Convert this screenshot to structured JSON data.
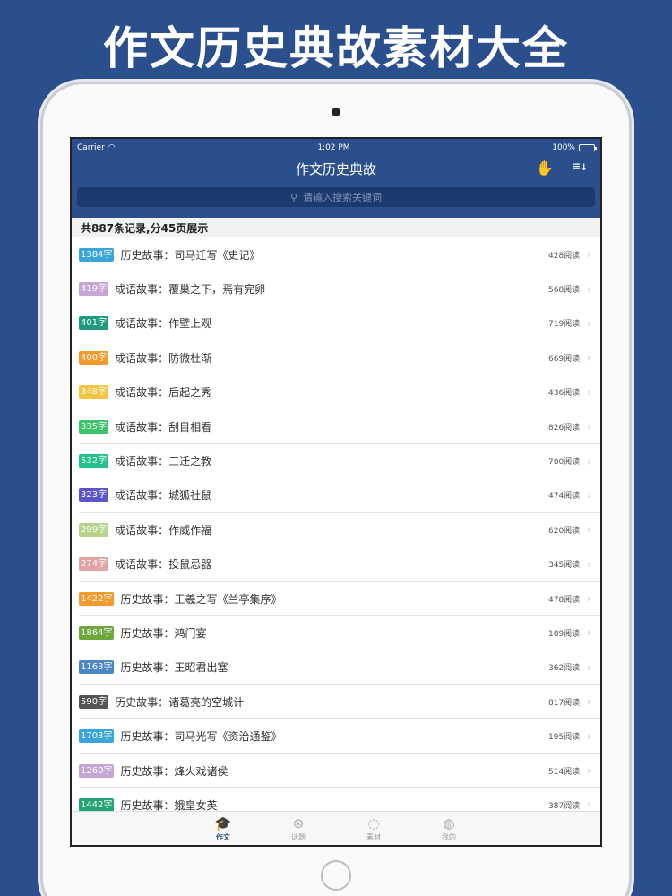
{
  "promo": {
    "title": "作文历史典故素材大全"
  },
  "status_bar": {
    "carrier": "Carrier",
    "time": "1:02 PM",
    "battery": "100%"
  },
  "navbar": {
    "title": "作文历史典故"
  },
  "search": {
    "placeholder": "请输入搜索关键词"
  },
  "summary": "共887条记录,分45页展示",
  "items": [
    {
      "count": "1384字",
      "color": "#3aa5d8",
      "title": "历史故事：司马迁写《史记》",
      "reads": "428阅读"
    },
    {
      "count": "419字",
      "color": "#c7a6d6",
      "title": "成语故事：覆巢之下，焉有完卵",
      "reads": "568阅读"
    },
    {
      "count": "401字",
      "color": "#1f9a7a",
      "title": "成语故事：作壁上观",
      "reads": "719阅读"
    },
    {
      "count": "400字",
      "color": "#f39a2c",
      "title": "成语故事：防微杜渐",
      "reads": "669阅读"
    },
    {
      "count": "348字",
      "color": "#f5c542",
      "title": "成语故事：后起之秀",
      "reads": "436阅读"
    },
    {
      "count": "335字",
      "color": "#3cc46b",
      "title": "成语故事：刮目相看",
      "reads": "826阅读"
    },
    {
      "count": "532字",
      "color": "#24c08e",
      "title": "成语故事：三迁之教",
      "reads": "780阅读"
    },
    {
      "count": "323字",
      "color": "#5c54c9",
      "title": "成语故事：城狐社鼠",
      "reads": "474阅读"
    },
    {
      "count": "299字",
      "color": "#b5d48a",
      "title": "成语故事：作威作福",
      "reads": "620阅读"
    },
    {
      "count": "274字",
      "color": "#e4a3a3",
      "title": "成语故事：投鼠忌器",
      "reads": "345阅读"
    },
    {
      "count": "1422字",
      "color": "#f39a2c",
      "title": "历史故事：王羲之写《兰亭集序》",
      "reads": "478阅读"
    },
    {
      "count": "1864字",
      "color": "#6da83a",
      "title": "历史故事：鸿门宴",
      "reads": "189阅读"
    },
    {
      "count": "1163字",
      "color": "#4a86c8",
      "title": "历史故事：王昭君出塞",
      "reads": "362阅读"
    },
    {
      "count": "590字",
      "color": "#555555",
      "title": "历史故事：诸葛亮的空城计",
      "reads": "817阅读"
    },
    {
      "count": "1703字",
      "color": "#3aa5d8",
      "title": "历史故事：司马光写《资治通鉴》",
      "reads": "195阅读"
    },
    {
      "count": "1260字",
      "color": "#c7a6d6",
      "title": "历史故事：烽火戏诸侯",
      "reads": "514阅读"
    },
    {
      "count": "1442字",
      "color": "#24a374",
      "title": "历史故事：娥皇女英",
      "reads": "387阅读"
    }
  ],
  "tabs": [
    {
      "label": "作文",
      "icon": "graduation-cap-icon",
      "active": true
    },
    {
      "label": "话题",
      "icon": "aperture-icon",
      "active": false
    },
    {
      "label": "素材",
      "icon": "lightbulb-icon",
      "active": false
    },
    {
      "label": "我的",
      "icon": "user-icon",
      "active": false
    }
  ]
}
